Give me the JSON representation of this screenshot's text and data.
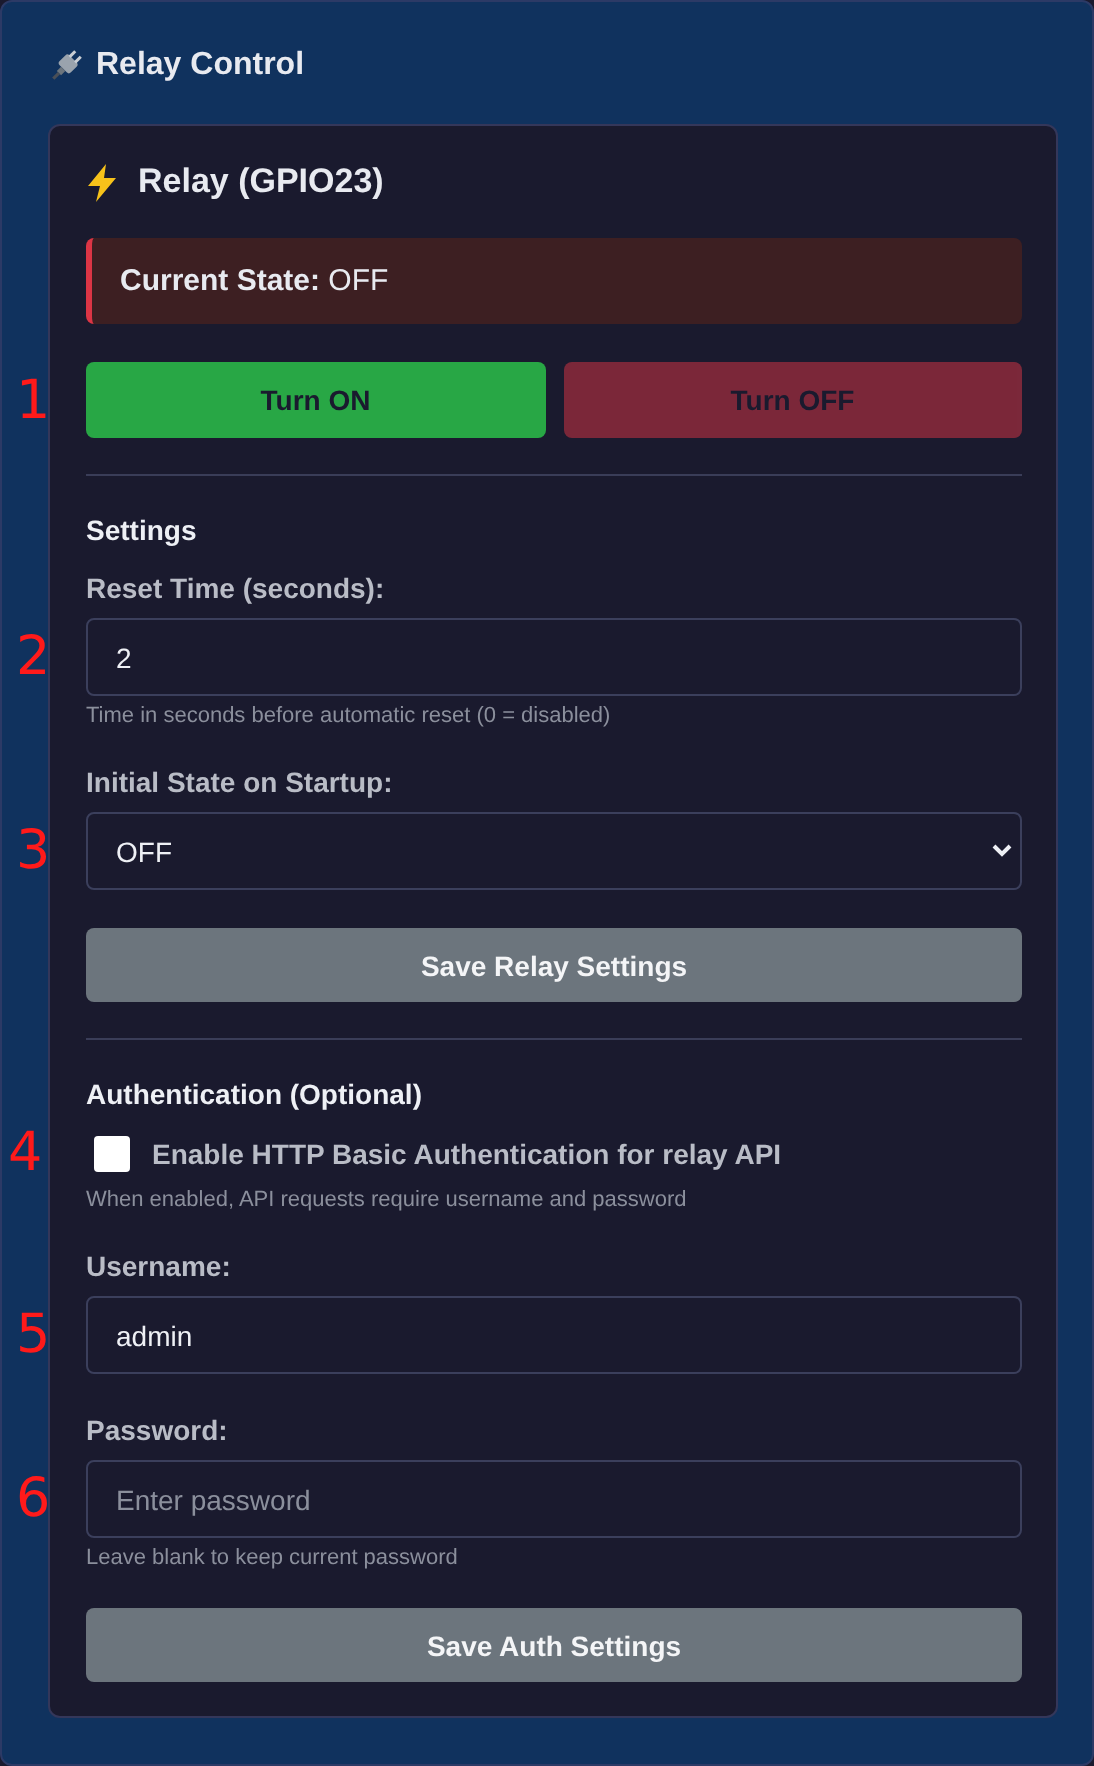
{
  "title": "Relay Control",
  "relay": {
    "name": "Relay (GPIO23)",
    "state": "**Current State:** OFF",
    "on": false
  },
  "controls": {
    "annotation": "1",
    "buttons": [
      {
        "label": "Turn ON",
        "kind": "on",
        "disabled": false
      },
      {
        "label": "Turn OFF",
        "kind": "off",
        "disabled": true
      }
    ]
  },
  "settings": {
    "heading": "Settings",
    "fields": [
      {
        "kind": "text",
        "label": "Reset Time (seconds):",
        "value": "2",
        "hint": "Time in seconds before automatic reset (0 = disabled)",
        "annotation": "2"
      },
      {
        "kind": "select",
        "label": "Initial State on Startup:",
        "value": "OFF",
        "annotation": "3"
      }
    ],
    "save_button": "Save Relay Settings"
  },
  "auth": {
    "heading": "Authentication (Optional)",
    "fields": [
      {
        "kind": "checkbox",
        "label": "Enable HTTP Basic Authentication for relay API",
        "checked": false,
        "hint": "When enabled, API requests require username and password",
        "annotation": "4"
      },
      {
        "kind": "text",
        "label": "Username:",
        "value": "admin",
        "annotation": "5"
      },
      {
        "kind": "password",
        "label": "Password:",
        "placeholder": "Enter password",
        "hint": "Leave blank to keep current password",
        "annotation": "6"
      }
    ],
    "save_button": "Save Auth Settings"
  }
}
